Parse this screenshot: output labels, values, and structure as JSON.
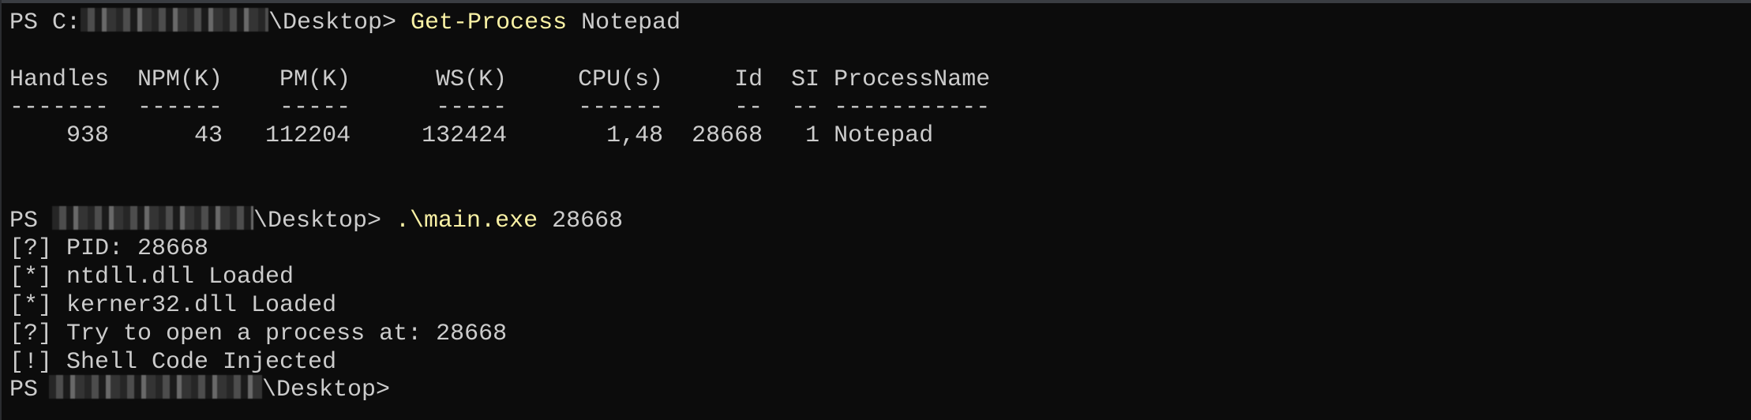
{
  "prompt1": {
    "prefix": "PS C:",
    "path_suffix": "\\Desktop> ",
    "command": "Get-Process",
    "argument": " Notepad"
  },
  "table": {
    "header": "Handles  NPM(K)    PM(K)      WS(K)     CPU(s)     Id  SI ProcessName",
    "separator": "-------  ------    -----      -----     ------     --  -- -----------",
    "columns": [
      "Handles",
      "NPM(K)",
      "PM(K)",
      "WS(K)",
      "CPU(s)",
      "Id",
      "SI",
      "ProcessName"
    ],
    "rows": [
      {
        "text": "    938      43   112204     132424       1,48  28668   1 Notepad",
        "values": [
          "938",
          "43",
          "112204",
          "132424",
          "1,48",
          "28668",
          "1",
          "Notepad"
        ]
      }
    ]
  },
  "prompt2": {
    "prefix": "PS ",
    "path_suffix": "\\Desktop> ",
    "command": ".\\main.exe",
    "argument": " 28668"
  },
  "output": [
    "[?] PID: 28668",
    "[*] ntdll.dll Loaded",
    "[*] kerner32.dll Loaded",
    "[?] Try to open a process at: 28668",
    "[!] Shell Code Injected"
  ],
  "prompt3": {
    "prefix": "PS ",
    "path_suffix": "\\Desktop>"
  },
  "colors": {
    "background": "#0c0c0c",
    "text": "#cccccc",
    "command": "#f9f1a5"
  }
}
